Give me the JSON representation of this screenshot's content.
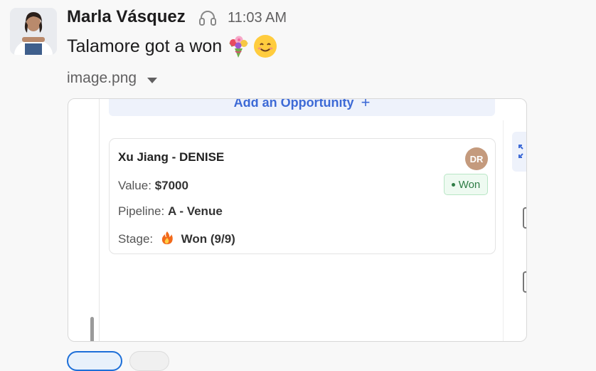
{
  "message": {
    "author": "Marla Vásquez",
    "status_icon": "headphones-icon",
    "time": "11:03 AM",
    "text": "Talamore got a won",
    "emojis": [
      "bouquet-emoji",
      "smiling-face-emoji"
    ]
  },
  "attachment": {
    "file_name": "image.png",
    "add_opportunity_label": "Add an Opportunity",
    "add_icon": "+",
    "card": {
      "title": "Xu Jiang - DENISE",
      "avatar_initials": "DR",
      "status_label": "Won",
      "value_label": "Value:",
      "value": "$7000",
      "pipeline_label": "Pipeline:",
      "pipeline": "A - Venue",
      "stage_label": "Stage:",
      "stage": "Won (9/9)"
    }
  },
  "colors": {
    "accent": "#1d6fd8",
    "won_green": "#2f7d46",
    "opportunity_blue": "#3d6ad6"
  }
}
